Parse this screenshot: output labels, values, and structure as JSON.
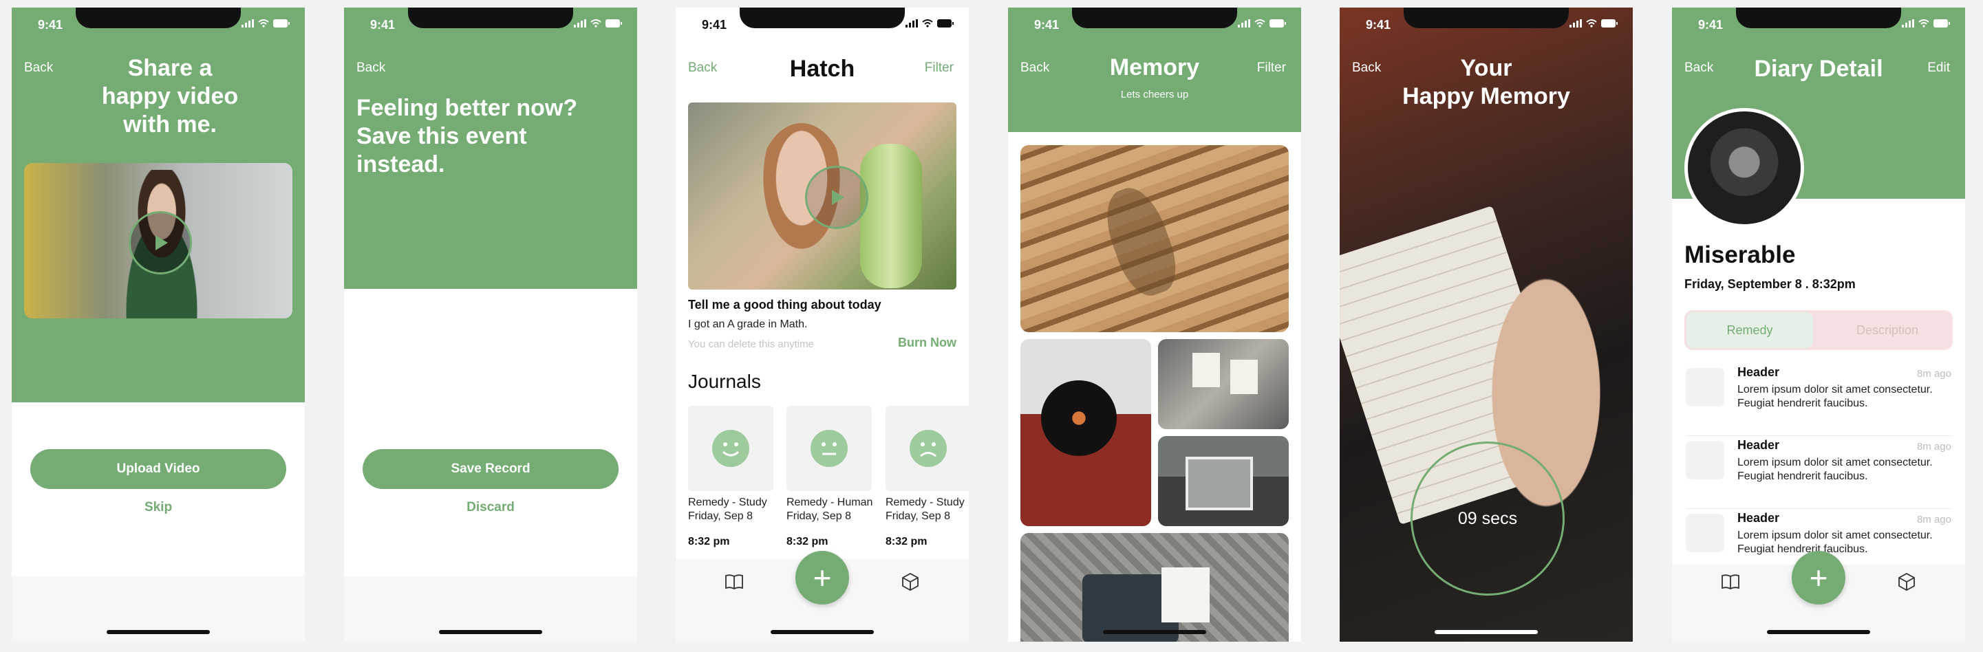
{
  "status": {
    "time": "9:41"
  },
  "screen1": {
    "back": "Back",
    "title_lines": [
      "Share a",
      "happy video",
      "with me."
    ],
    "primary_button": "Upload Video",
    "secondary_link": "Skip"
  },
  "screen2": {
    "back": "Back",
    "title_lines": [
      "Feeling better now?",
      "Save this event",
      "instead."
    ],
    "primary_button": "Save Record",
    "secondary_link": "Discard"
  },
  "screen3": {
    "back": "Back",
    "title": "Hatch",
    "filter": "Filter",
    "prompt": "Tell me a good thing about today",
    "answer": "I got an A grade in Math.",
    "hint": "You can delete this anytime",
    "burn": "Burn Now",
    "journals_title": "Journals",
    "journals": [
      {
        "line1": "Remedy - Study",
        "line2": "Friday, Sep 8",
        "time": "8:32 pm",
        "mood": "happy"
      },
      {
        "line1": "Remedy - Human",
        "line2": "Friday, Sep 8",
        "time": "8:32 pm",
        "mood": "neutral"
      },
      {
        "line1": "Remedy - Study",
        "line2": "Friday, Sep 8",
        "time": "8:32 pm",
        "mood": "sad"
      }
    ]
  },
  "screen4": {
    "back": "Back",
    "title": "Memory",
    "subtitle": "Lets cheers up",
    "filter": "Filter"
  },
  "screen5": {
    "back": "Back",
    "title_lines": [
      "Your",
      "Happy Memory"
    ],
    "timer": "09 secs"
  },
  "screen6": {
    "back": "Back",
    "title": "Diary Detail",
    "edit": "Edit",
    "mood": "Miserable",
    "date": "Friday, September 8 . 8:32pm",
    "tabs": [
      "Remedy",
      "Description"
    ],
    "items": [
      {
        "header": "Header",
        "time": "8m ago",
        "body": "Lorem ipsum dolor sit amet consectetur. Feugiat hendrerit faucibus."
      },
      {
        "header": "Header",
        "time": "8m ago",
        "body": "Lorem ipsum dolor sit amet consectetur. Feugiat hendrerit faucibus."
      },
      {
        "header": "Header",
        "time": "8m ago",
        "body": "Lorem ipsum dolor sit amet consectetur. Feugiat hendrerit faucibus."
      }
    ]
  },
  "colors": {
    "accent": "#74ac74",
    "accent_light": "#e7f0e7",
    "tab_inactive": "#f5e1e1"
  },
  "icons": [
    "play-icon",
    "book-icon",
    "plus-icon",
    "cube-icon",
    "signal-icon",
    "wifi-icon",
    "battery-icon"
  ]
}
